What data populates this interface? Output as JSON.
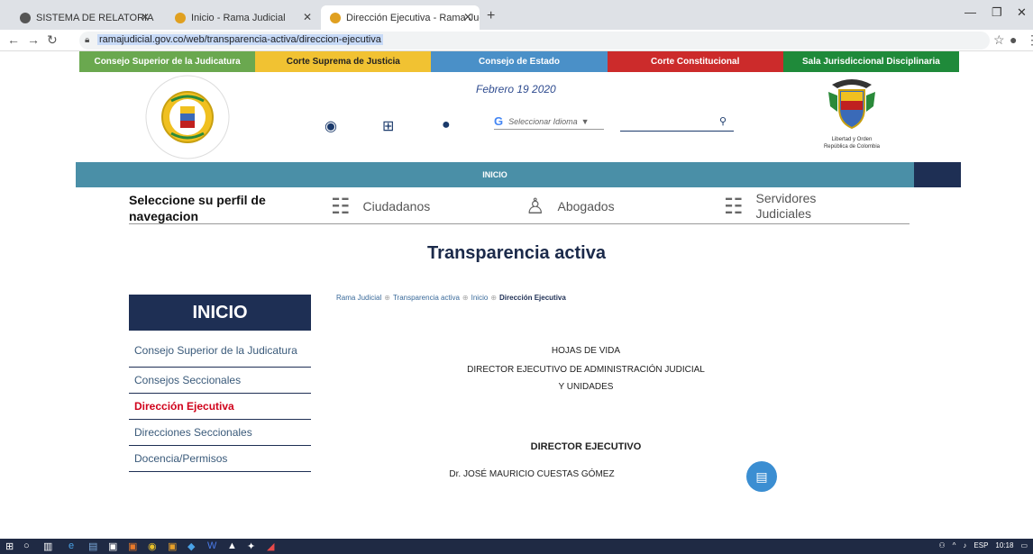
{
  "browser": {
    "tabs": [
      {
        "title": "SISTEMA DE RELATORIA",
        "active": false
      },
      {
        "title": "Inicio - Rama Judicial",
        "active": false
      },
      {
        "title": "Dirección Ejecutiva - Rama Judic",
        "active": true
      }
    ],
    "new_tab": "+",
    "url": "ramajudicial.gov.co/web/transparencia-activa/direccion-ejecutiva"
  },
  "topnav": [
    {
      "label": "Consejo Superior de la Judicatura",
      "color": "#6aa84f"
    },
    {
      "label": "Corte Suprema de Justicia",
      "color": "#f1c232"
    },
    {
      "label": "Consejo de Estado",
      "color": "#4a90c8"
    },
    {
      "label": "Corte Constitucional",
      "color": "#cc2b2b"
    },
    {
      "label": "Sala Jurisdiccional Disciplinaria",
      "color": "#1f8a3a"
    }
  ],
  "header": {
    "logo_left_text_top": "RAMA JUDICIAL",
    "logo_left_text_bottom": "REPÚBLICA DE COLOMBIA",
    "date": "Febrero 19 2020",
    "language_placeholder": "Seleccionar Idioma",
    "language_arrow": "▼",
    "logo_right_caption_1": "Libertad y Orden",
    "logo_right_caption_2": "República de Colombia"
  },
  "inicio_bar": "INICIO",
  "perfil": {
    "title": "Seleccione su perfil de navegacion",
    "options": [
      "Ciudadanos",
      "Abogados",
      "Servidores Judiciales"
    ]
  },
  "page_title": "Transparencia activa",
  "sidebar": {
    "head": "INICIO",
    "items": [
      {
        "label": "Consejo Superior de la Judicatura",
        "active": false
      },
      {
        "label": "Consejos Seccionales",
        "active": false
      },
      {
        "label": "Dirección Ejecutiva",
        "active": true
      },
      {
        "label": "Direcciones Seccionales",
        "active": false
      },
      {
        "label": "Docencia/Permisos",
        "active": false
      }
    ]
  },
  "breadcrumb": {
    "items": [
      "Rama Judicial",
      "Transparencia activa",
      "Inicio",
      "Dirección Ejecutiva"
    ],
    "sep": "⊕"
  },
  "content": {
    "line1": "HOJAS DE VIDA",
    "line2": "DIRECTOR EJECUTIVO DE ADMINISTRACIÓN JUDICIAL",
    "line3": "Y UNIDADES",
    "section_title": "DIRECTOR EJECUTIVO",
    "person": "Dr. JOSÉ MAURICIO CUESTAS GÓMEZ"
  },
  "taskbar": {
    "tray_lang": "ESP",
    "time": "10:18"
  }
}
